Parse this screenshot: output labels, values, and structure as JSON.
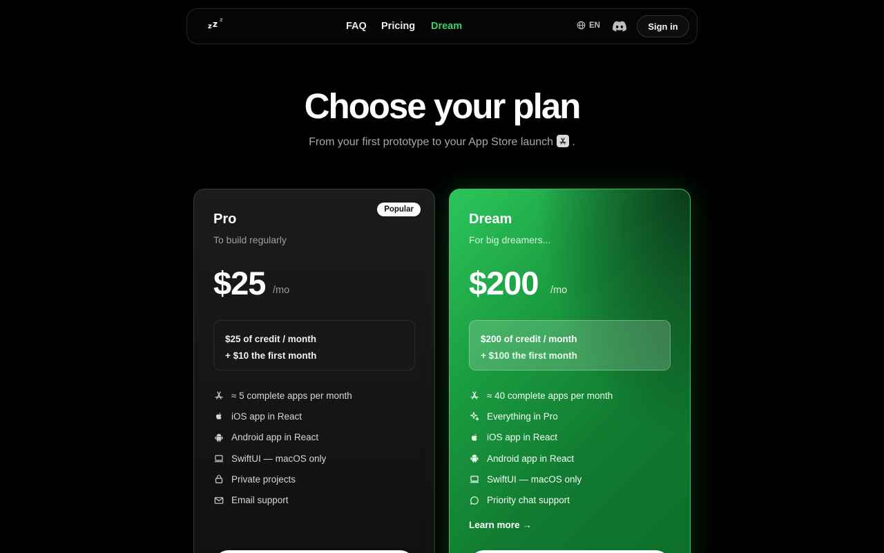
{
  "nav": {
    "links": [
      "FAQ",
      "Pricing",
      "Dream"
    ],
    "active_color": "#3ecf6a",
    "language": "EN",
    "signin_label": "Sign in"
  },
  "hero": {
    "title": "Choose your plan",
    "subtitle": "From your first prototype to your App Store launch",
    "subtitle_end": "."
  },
  "plans": [
    {
      "name": "Pro",
      "badge": "Popular",
      "tagline": "To build regularly",
      "price": "$25",
      "period": "/mo",
      "credit_line1": "$25 of credit / month",
      "credit_line2": "+ $10 the first month",
      "features": [
        {
          "icon": "app-store-icon",
          "text": "≈ 5 complete apps per month"
        },
        {
          "icon": "apple-icon",
          "text": "iOS app in React"
        },
        {
          "icon": "android-icon",
          "text": "Android app in React"
        },
        {
          "icon": "laptop-icon",
          "text": "SwiftUI — macOS only"
        },
        {
          "icon": "lock-icon",
          "text": "Private projects"
        },
        {
          "icon": "mail-icon",
          "text": "Email support"
        }
      ]
    },
    {
      "name": "Dream",
      "tagline": "For big dreamers...",
      "price": "$200",
      "period": "/mo",
      "credit_line1": "$200 of credit / month",
      "credit_line2": "+ $100 the first month",
      "features": [
        {
          "icon": "app-store-icon",
          "text": "≈ 40 complete apps per month"
        },
        {
          "icon": "sparkles-icon",
          "text": "Everything in Pro"
        },
        {
          "icon": "apple-icon",
          "text": "iOS app in React"
        },
        {
          "icon": "android-icon",
          "text": "Android app in React"
        },
        {
          "icon": "laptop-icon",
          "text": "SwiftUI — macOS only"
        },
        {
          "icon": "chat-icon",
          "text": "Priority chat support"
        }
      ],
      "learn_more": "Learn more →",
      "accent": "#2cc55a"
    }
  ]
}
